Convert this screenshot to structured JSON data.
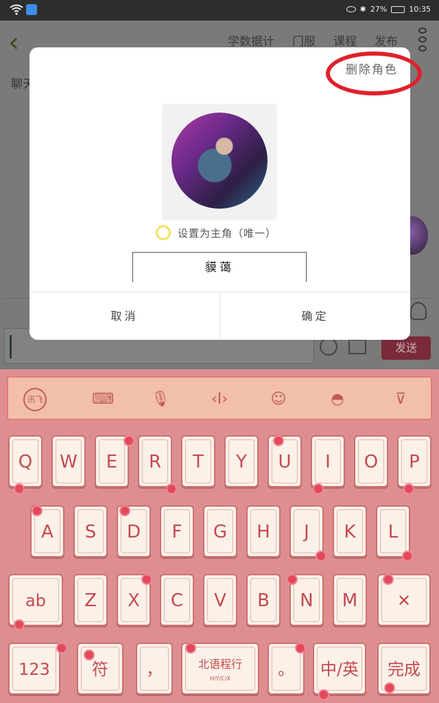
{
  "status_bar": {
    "battery": "27%",
    "time": "10:35"
  },
  "background_app": {
    "nav_items": [
      "学数据计",
      "门服",
      "课程",
      "发布"
    ],
    "left_text": "聊天",
    "send_label": "发送"
  },
  "dialog": {
    "delete_label": "删除角色",
    "radio_label": "设置为主角（唯一）",
    "name_value": "貘蔼",
    "cancel_label": "取消",
    "confirm_label": "确定"
  },
  "keyboard": {
    "toolbar": [
      "讯飞",
      "键盘",
      "语音",
      "光标",
      "表情",
      "皮肤",
      "收起"
    ],
    "row1": [
      "Q",
      "W",
      "E",
      "R",
      "T",
      "Y",
      "U",
      "I",
      "O",
      "P"
    ],
    "row2": [
      "A",
      "S",
      "D",
      "F",
      "G",
      "H",
      "J",
      "K",
      "L"
    ],
    "row3": [
      "Z",
      "X",
      "C",
      "V",
      "B",
      "N",
      "M"
    ],
    "shift_label": "ab",
    "delete_symbol": "✕",
    "num_label": "123",
    "symbol_label": "符",
    "comma_label": "，",
    "space_label": "北语程行",
    "space_sub": "H/Y/C/X",
    "period_label": "。",
    "lang_label": "中/英",
    "done_label": "完成"
  },
  "colors": {
    "accent_red": "#e0212c",
    "key_text": "#c4494d",
    "keyboard_bg": "#de8e91"
  }
}
